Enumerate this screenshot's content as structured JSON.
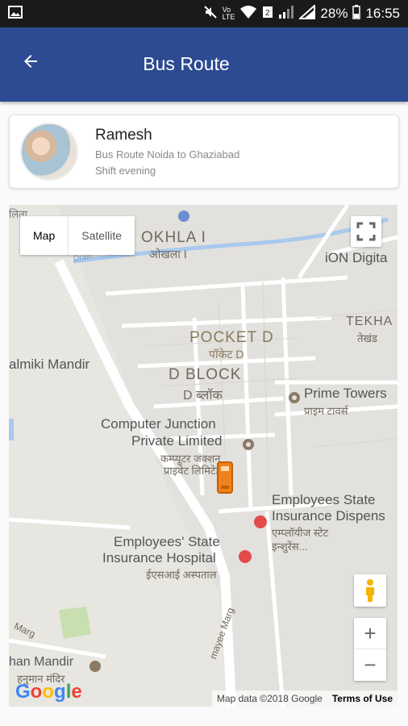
{
  "status_bar": {
    "battery": "28%",
    "time": "16:55"
  },
  "app_bar": {
    "title": "Bus Route"
  },
  "driver_card": {
    "name": "Ramesh",
    "route": "Bus Route Noida to Ghaziabad",
    "shift": "Shift evening"
  },
  "map": {
    "type_control": [
      "Map",
      "Satellite"
    ],
    "labels": {
      "okhla": "OKHLA I",
      "okhla_hi": "ओखला I",
      "ion": "iON Digita",
      "tekha": "TEKHA",
      "tekha_hi": "तेखंड",
      "pocket_d": "POCKET D",
      "pocket_d_hi": "पॉकेट D",
      "d_block": "D BLOCK",
      "d_block_hi": "D ब्लॉक",
      "valmiki": "almiki Mandir",
      "prime": "Prime Towers",
      "prime_hi": "प्राइम टावर्स",
      "cj1": "Computer Junction",
      "cj2": "Private Limited",
      "cj_hi1": "कम्प्यूटर जंक्शन",
      "cj_hi2": "प्राइवेट लिमिटेड",
      "esi1": "Employees State",
      "esi2": "Insurance Dispens",
      "esi_hi1": "एम्प्लॉयीज स्टेट",
      "esi_hi2": "इन्शुरेंस...",
      "esh1": "Employees' State",
      "esh2": "Insurance Hospital",
      "esh_hi": "ईएसआई अस्पताल",
      "hanuman": "han Mandir",
      "hanuman_hi": "हनुमान मंदिर",
      "marg": "Marg",
      "mayee": "mayee Marg",
      "drain": "Drain",
      "top_left": "लिता"
    },
    "zoom_in": "+",
    "zoom_out": "−",
    "google_logo": "Google",
    "attribution": "Map data ©2018 Google",
    "terms": "Terms of Use"
  },
  "colors": {
    "app_bar": "#2d4b92",
    "status_bar": "#1a1a1a",
    "bus_marker": "#f0821e"
  },
  "icons": {
    "back": "arrow-left-icon",
    "fullscreen": "fullscreen-icon",
    "pegman": "pegman-icon",
    "bus": "bus-marker-icon"
  }
}
